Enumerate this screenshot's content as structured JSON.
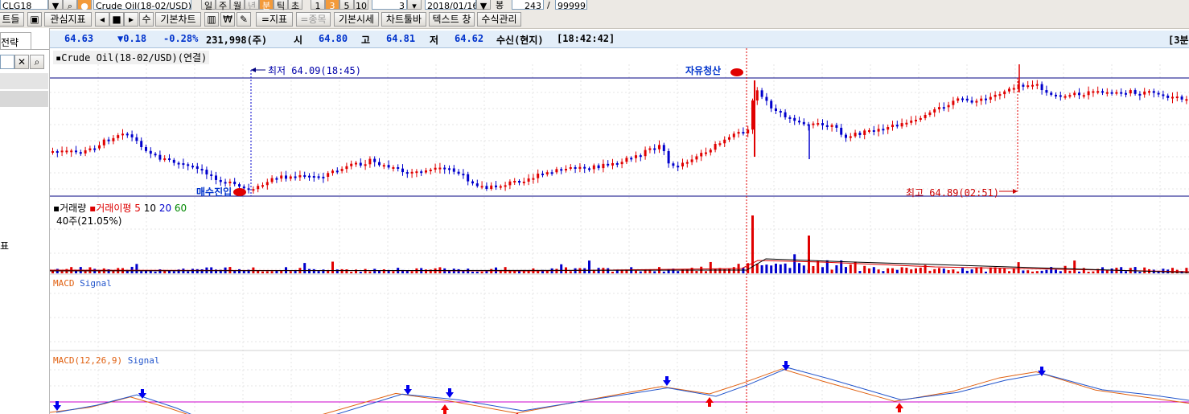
{
  "toolbar_top": {
    "symbol": "CLG18",
    "name": "Crude Oil(18-02/USD)",
    "period_buttons": [
      "일",
      "주",
      "월",
      "년",
      "분",
      "틱",
      "초"
    ],
    "interval_buttons": [
      "1",
      "3",
      "5",
      "10"
    ],
    "interval_value": "3",
    "date": "2018/01/16",
    "count_label": "봉",
    "count_value": "243",
    "slash": "/",
    "max_value": "99999"
  },
  "toolbar": {
    "left_partial": "트들",
    "indicator": "관심지표",
    "basic_chart": "기본차트",
    "add_indicator": "=지표",
    "add_item": "=종목",
    "basic_quote": "기본시세",
    "chart_toolbar": "차트툴바",
    "text_window": "텍스트 창",
    "formula": "수식관리"
  },
  "left_panel": {
    "tab": "전략",
    "partial_label": "표"
  },
  "quote": {
    "price": "64.63",
    "change": "▼0.18",
    "change_pct": "-0.28%",
    "volume": "231,998(주)",
    "open_label": "시",
    "open": "64.80",
    "high_label": "고",
    "high": "64.81",
    "low_label": "저",
    "low": "64.62",
    "status": "수신(현지)",
    "time": "[18:42:42]",
    "right_partial": "[3분"
  },
  "price_panel": {
    "title": "Crude Oil(18-02/USD)(연결)",
    "low_label": "최저 64.09(18:45)",
    "high_label": "최고 64.89(02:51)",
    "buy_label": "매수진입",
    "sell_label": "자유청산"
  },
  "volume_panel": {
    "title": "거래량",
    "ma_title": "거래이평",
    "ma_periods": [
      "5",
      "10",
      "20",
      "60"
    ],
    "ma_colors": [
      "#dd0000",
      "#000000",
      "#0000cc",
      "#008800"
    ],
    "value": "40주(21.05%)"
  },
  "macd_panel1": {
    "title": "MACD",
    "signal": "Signal"
  },
  "macd_panel2": {
    "title": "MACD(12,26,9)",
    "signal": "Signal"
  },
  "colors": {
    "up": "#e00000",
    "down": "#0000cc",
    "macd": "#e06010",
    "signal": "#2255cc",
    "zero": "#cc00cc"
  }
}
